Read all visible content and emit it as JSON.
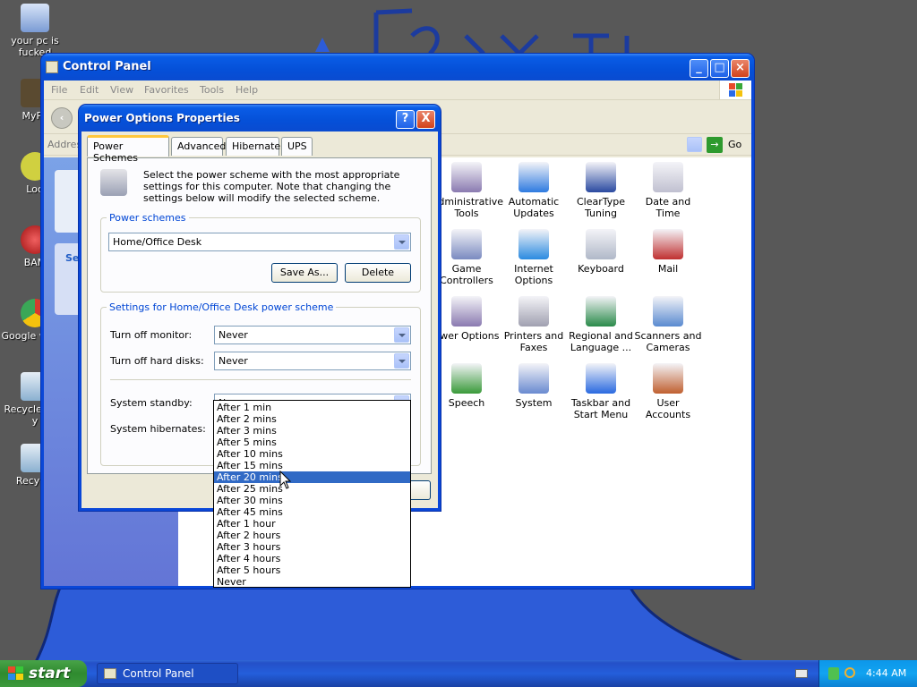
{
  "desktop": {
    "icons": [
      {
        "label": "your pc is fucked"
      },
      {
        "label": "MyPa"
      },
      {
        "label": "Loo"
      },
      {
        "label": "BAM"
      },
      {
        "label": "Google w you"
      },
      {
        "label": "Recycle fuck y"
      },
      {
        "label": "Recycle"
      }
    ]
  },
  "control_panel": {
    "title": "Control Panel",
    "menu": [
      "File",
      "Edit",
      "View",
      "Favorites",
      "Tools",
      "Help"
    ],
    "address_label": "Addres",
    "go_label": "Go",
    "sidepane_heading": "Se",
    "items": [
      {
        "label": "Administrative Tools"
      },
      {
        "label": "Automatic Updates"
      },
      {
        "label": "ClearType Tuning"
      },
      {
        "label": "Date and Time"
      },
      {
        "label": "Game Controllers"
      },
      {
        "label": "Internet Options"
      },
      {
        "label": "Keyboard"
      },
      {
        "label": "Mail"
      },
      {
        "label": "ower Options"
      },
      {
        "label": "Printers and Faxes"
      },
      {
        "label": "Regional and Language ..."
      },
      {
        "label": "Scanners and Cameras"
      },
      {
        "label": "Speech"
      },
      {
        "label": "System"
      },
      {
        "label": "Taskbar and Start Menu"
      },
      {
        "label": "User Accounts"
      }
    ]
  },
  "dialog": {
    "title": "Power Options Properties",
    "help_btn": "?",
    "close_btn": "X",
    "tabs": [
      "Power Schemes",
      "Advanced",
      "Hibernate",
      "UPS"
    ],
    "description": "Select the power scheme with the most appropriate settings for this computer. Note that changing the settings below will modify the selected scheme.",
    "schemes_group": "Power schemes",
    "scheme_value": "Home/Office Desk",
    "save_as": "Save As...",
    "delete": "Delete",
    "settings_group": "Settings for Home/Office Desk power scheme",
    "monitor_label": "Turn off monitor:",
    "monitor_value": "Never",
    "disks_label": "Turn off hard disks:",
    "disks_value": "Never",
    "standby_label": "System standby:",
    "standby_value": "Never",
    "hibernate_label": "System hibernates:",
    "dropdown_options": [
      "After 1 min",
      "After 2 mins",
      "After 3 mins",
      "After 5 mins",
      "After 10 mins",
      "After 15 mins",
      "After 20 mins",
      "After 25 mins",
      "After 30 mins",
      "After 45 mins",
      "After 1 hour",
      "After 2 hours",
      "After 3 hours",
      "After 4 hours",
      "After 5 hours",
      "Never"
    ],
    "dropdown_selected": "After 20 mins"
  },
  "taskbar": {
    "start": "start",
    "task": "Control Panel",
    "clock": "4:44 AM"
  },
  "colors": {
    "xp_blue": "#0a47d8",
    "selection": "#316ac5",
    "start_green": "#3c9a3c",
    "desktop_bg": "#585858"
  }
}
